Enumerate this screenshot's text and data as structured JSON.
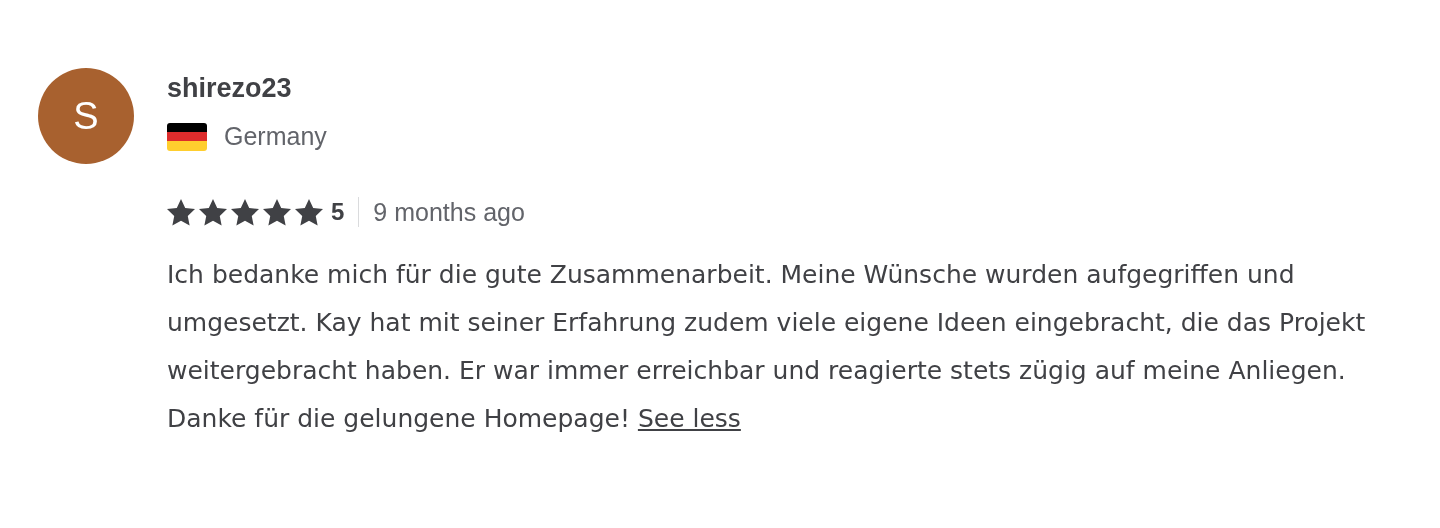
{
  "review": {
    "avatar_initial": "S",
    "username": "shirezo23",
    "country": "Germany",
    "stars": 5,
    "rating": "5",
    "time": "9 months ago",
    "text": "Ich bedanke mich für die gute Zusammenarbeit. Meine Wünsche wurden aufgegriffen und umgesetzt. Kay hat mit seiner Erfahrung zudem viele eigene Ideen eingebracht, die das Projekt weitergebracht haben. Er war immer erreichbar und reagierte stets zügig auf meine Anliegen. Danke für die gelungene Homepage!",
    "toggle_link": "See less"
  }
}
